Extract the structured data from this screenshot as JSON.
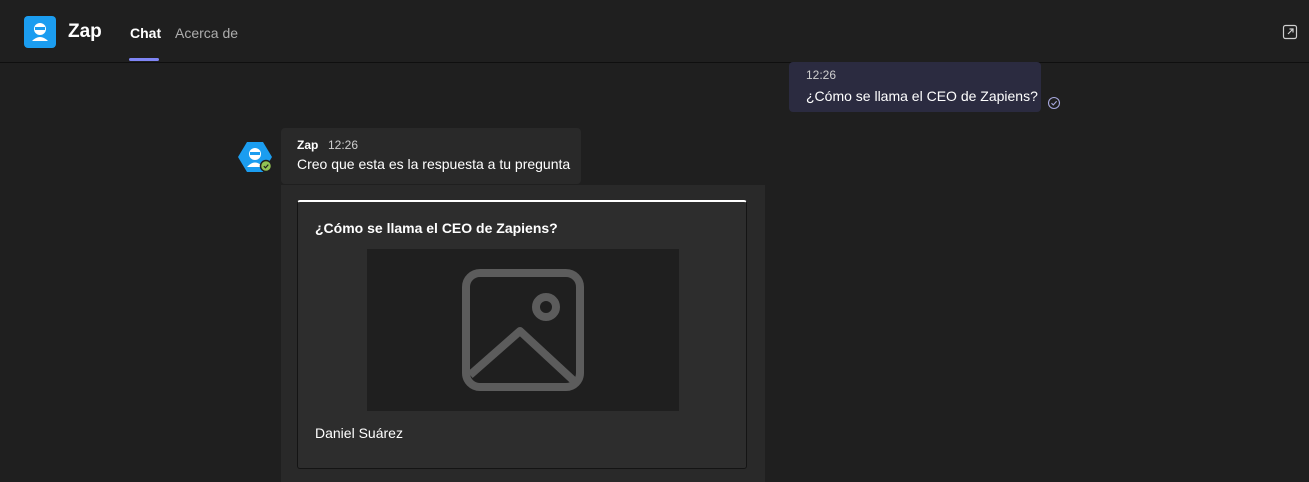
{
  "app": {
    "title": "Zap",
    "logo_icon": "bot-icon",
    "accent": "#1b9df0"
  },
  "tabs": [
    {
      "label": "Chat",
      "active": true
    },
    {
      "label": "Acerca de",
      "active": false
    }
  ],
  "toolbar": {
    "popout_icon": "popout-icon"
  },
  "messages": {
    "user": {
      "time": "12:26",
      "text": "¿Cómo se llama el CEO de Zapiens?",
      "status_icon": "read-receipt-icon"
    },
    "bot": {
      "name": "Zap",
      "time": "12:26",
      "text": "Creo que esta es la respuesta a tu pregunta",
      "presence": "available"
    }
  },
  "card": {
    "title": "¿Cómo se llama el CEO de Zapiens?",
    "image_icon": "image-placeholder-icon",
    "caption": "Daniel Suárez"
  }
}
